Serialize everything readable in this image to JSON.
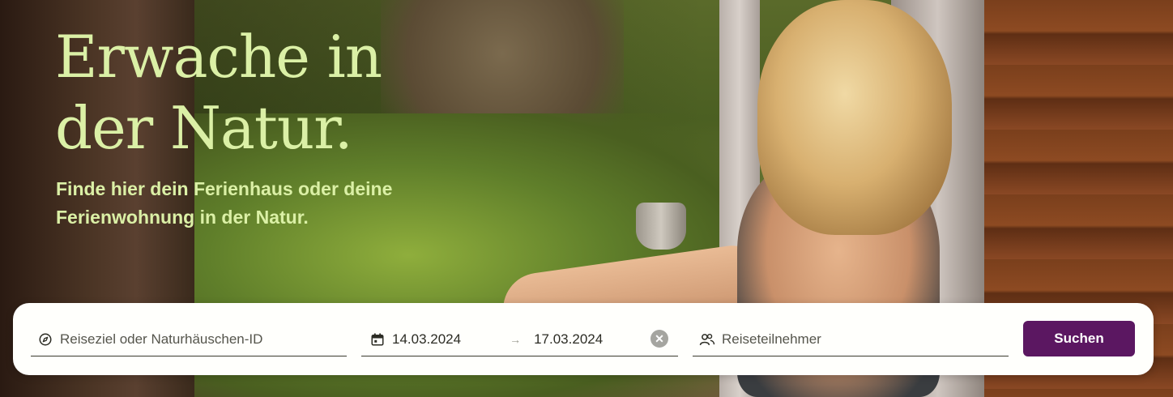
{
  "hero": {
    "headline": "Erwache in\nder Natur.",
    "subline": "Finde hier dein Ferienhaus oder deine Ferienwohnung in der Natur."
  },
  "search": {
    "destination": {
      "placeholder": "Reiseziel oder Naturhäuschen-ID",
      "icon": "compass-icon"
    },
    "dates": {
      "start": "14.03.2024",
      "end": "17.03.2024",
      "icon": "calendar-icon",
      "arrow": "→",
      "clear_icon": "close-circle-icon"
    },
    "guests": {
      "placeholder": "Reiseteilnehmer",
      "icon": "users-icon"
    },
    "button_label": "Suchen"
  },
  "colors": {
    "headline": "#dbf0a6",
    "button": "#5b1761",
    "searchbar_bg": "#fffffc"
  }
}
